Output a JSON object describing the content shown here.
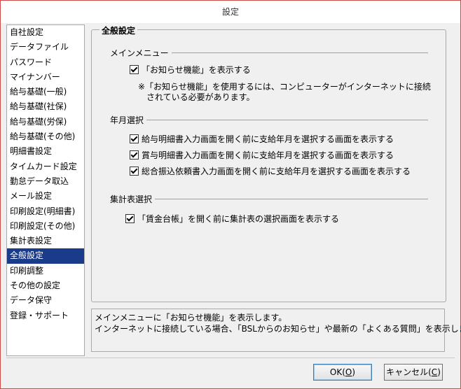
{
  "window": {
    "title": "設定"
  },
  "sidebar": {
    "selected_index": 15,
    "items": [
      {
        "label": "自社設定"
      },
      {
        "label": "データファイル"
      },
      {
        "label": "パスワード"
      },
      {
        "label": "マイナンバー"
      },
      {
        "label": "給与基礎(一般)"
      },
      {
        "label": "給与基礎(社保)"
      },
      {
        "label": "給与基礎(労保)"
      },
      {
        "label": "給与基礎(その他)"
      },
      {
        "label": "明細書設定"
      },
      {
        "label": "タイムカード設定"
      },
      {
        "label": "勤怠データ取込"
      },
      {
        "label": "メール設定"
      },
      {
        "label": "印刷設定(明細書)"
      },
      {
        "label": "印刷設定(その他)"
      },
      {
        "label": "集計表設定"
      },
      {
        "label": "全般設定"
      },
      {
        "label": "印刷調整"
      },
      {
        "label": "その他の設定"
      },
      {
        "label": "データ保守"
      },
      {
        "label": "登録・サポート"
      }
    ]
  },
  "main": {
    "group_title": "全般設定",
    "main_menu": {
      "title": "メインメニュー",
      "option_label": "「お知らせ機能」を表示する",
      "option_checked": true,
      "note_line1": "※「お知らせ機能」を使用するには、コンピューターがインターネットに接続",
      "note_line2": "されている必要があります。"
    },
    "year_month": {
      "title": "年月選択",
      "options": [
        {
          "label": "給与明細書入力画面を開く前に支給年月を選択する画面を表示する",
          "checked": true
        },
        {
          "label": "賞与明細書入力画面を開く前に支給年月を選択する画面を表示する",
          "checked": true
        },
        {
          "label": "総合振込依頼書入力画面を開く前に支給年月を選択する画面を表示する",
          "checked": true
        }
      ]
    },
    "summary": {
      "title": "集計表選択",
      "option_label": "「賃金台帳」を開く前に集計表の選択画面を表示する",
      "option_checked": true
    }
  },
  "description": {
    "line1": "メインメニューに「お知らせ機能」を表示します。",
    "line2": "インターネットに接続している場合、「BSLからのお知らせ」や最新の「よくある質問」を表示します。"
  },
  "buttons": {
    "ok_label": "OK(",
    "ok_key": "O",
    "ok_suffix": ")",
    "cancel_label": "キャンセル(",
    "cancel_key": "C",
    "cancel_suffix": ")"
  },
  "colors": {
    "selection": "#1a3a8a",
    "window_border": "#d04a4a"
  }
}
